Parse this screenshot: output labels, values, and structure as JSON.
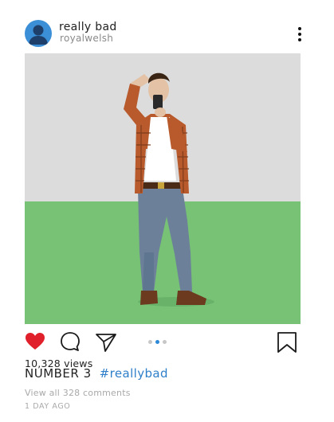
{
  "post": {
    "username": "really bad",
    "handle": "royalwelsh",
    "avatar_icon": "user-avatar-icon",
    "more_icon": "more-vertical-icon",
    "views": "10,328 views",
    "caption_title": "NUMBER 3",
    "hashtag": "#reallybad",
    "view_comments": "View all 328 comments",
    "timestamp": "1 DAY AGO"
  },
  "actions": {
    "like_icon": "heart-icon",
    "comment_icon": "comment-icon",
    "share_icon": "send-icon",
    "save_icon": "bookmark-icon",
    "liked": true
  },
  "carousel": {
    "count": 3,
    "active_index": 1
  },
  "colors": {
    "like": "#e0202a",
    "link": "#2e7fc9",
    "carousel_active": "#2e8ad8",
    "avatar": "#3b8fd6",
    "photo_wall": "#dcdcdc",
    "photo_grass": "#77c275"
  }
}
